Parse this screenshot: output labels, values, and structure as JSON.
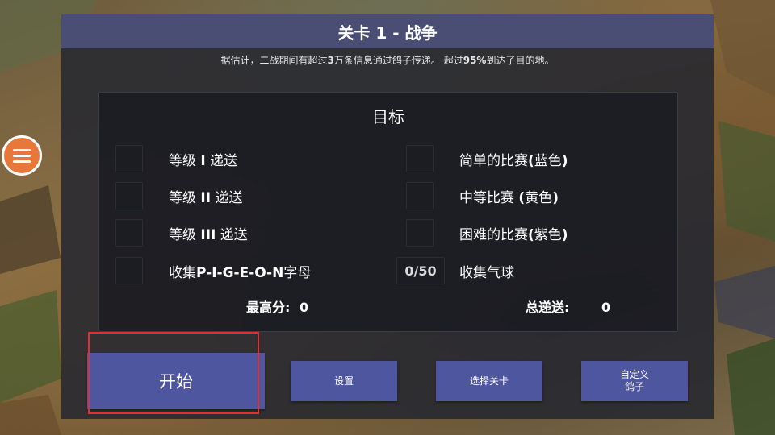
{
  "header": {
    "title": "关卡 1 - 战争",
    "subtitle_parts": [
      "据估计，二战期间有超过",
      "3",
      "万条信息通过鸽子传递。 超过",
      "95%",
      "到达了目的地。"
    ]
  },
  "objectives": {
    "title": "目标",
    "left": [
      {
        "label_a": "等级 ",
        "label_b": "I",
        "label_c": " 递送",
        "done": false
      },
      {
        "label_a": "等级 ",
        "label_b": "II",
        "label_c": " 递送",
        "done": false
      },
      {
        "label_a": "等级 ",
        "label_b": "III",
        "label_c": " 递送",
        "done": false
      },
      {
        "label_a": "收集",
        "label_b": "P-I-G-E-O-N",
        "label_c": "字母",
        "done": false
      }
    ],
    "right": [
      {
        "label_a": "简单的比赛",
        "label_b": "(",
        "label_c": "蓝色",
        "label_d": ")",
        "done": false
      },
      {
        "label_a": "中等比赛 ",
        "label_b": "(",
        "label_c": "黄色",
        "label_d": ")",
        "done": false
      },
      {
        "label_a": "困难的比赛",
        "label_b": "(",
        "label_c": "紫色",
        "label_d": ")",
        "done": false
      }
    ],
    "balloons": {
      "count": "0/50",
      "label": "收集气球"
    },
    "high_score": {
      "label": "最高分:",
      "value": "0"
    },
    "total_delivered": {
      "label": "总递送:",
      "value": "0"
    }
  },
  "buttons": {
    "start": "开始",
    "settings": "设置",
    "select_level": "选择关卡",
    "custom_pigeon_line1": "自定义",
    "custom_pigeon_line2": "鸽子"
  },
  "icons": {
    "menu": "hamburger-menu-icon"
  },
  "colors": {
    "accent_button": "#4e56a0",
    "title_bar": "#4a4e74",
    "menu_button": "#e8773a",
    "highlight": "#e03030"
  }
}
